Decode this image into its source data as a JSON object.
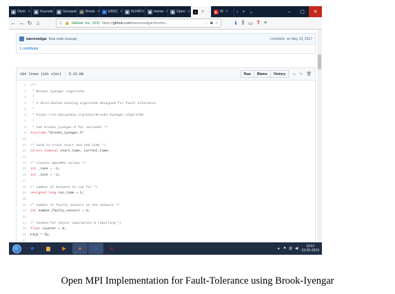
{
  "browser": {
    "tabs": [
      {
        "label": "Olym",
        "icon": "globe-icon"
      },
      {
        "label": "Keynote",
        "icon": "globe-icon"
      },
      {
        "label": "Geospatia",
        "icon": "globe-icon"
      },
      {
        "label": "Brook",
        "icon": "w-icon"
      },
      {
        "label": "EBSC",
        "icon": "ebsco-icon"
      },
      {
        "label": "8c2467c1",
        "icon": "globe-icon"
      },
      {
        "label": "meme",
        "icon": "globe-icon"
      },
      {
        "label": "Open",
        "icon": "globe-icon"
      },
      {
        "label": "",
        "icon": "github-icon",
        "active": true
      },
      {
        "label": "W",
        "icon": "youtube-icon"
      }
    ],
    "new_tab": "+",
    "url": {
      "site_identity": "GitHub, Inc. (US)",
      "prefix": "https://",
      "host": "github.com",
      "path": "/warrenedgar/brooks..."
    }
  },
  "commit": {
    "author": "warrenedgar",
    "message": "final code cleanup",
    "sha": "c4eb96d",
    "date": "on May 19, 2017",
    "contributors": "1 contributor"
  },
  "file": {
    "lines_info": "194 lines (161 sloc)",
    "size": "5.23 KB",
    "buttons": {
      "raw": "Raw",
      "blame": "Blame",
      "history": "History"
    }
  },
  "code_lines": [
    {
      "n": "1",
      "t": "/**",
      "c": "comment"
    },
    {
      "n": "2",
      "t": " * Brooks Iyengar Algorithm",
      "c": "comment"
    },
    {
      "n": "3",
      "t": " *",
      "c": "comment"
    },
    {
      "n": "4",
      "t": " * A distributed sensing algorithm designed for fault tolerance.",
      "c": "comment"
    },
    {
      "n": "5",
      "t": " *",
      "c": "comment"
    },
    {
      "n": "6",
      "t": " * https://en.wikipedia.org/wiki/Brooks-Iyengar_algorithm",
      "c": "comment"
    },
    {
      "n": "7",
      "t": " *",
      "c": "comment"
    },
    {
      "n": "8",
      "t": " * see brooks_iyengar.h for includes */",
      "c": "comment"
    },
    {
      "n": "9",
      "t": "#include \"brooks_iyengar.h\"",
      "c": "keyword"
    },
    {
      "n": "10",
      "t": "",
      "c": "plain"
    },
    {
      "n": "11",
      "t": "/* used to track start and end time */",
      "c": "comment"
    },
    {
      "n": "12",
      "t": "struct timeval start_time, current_time;",
      "c": "keyword"
    },
    {
      "n": "13",
      "t": "",
      "c": "plain"
    },
    {
      "n": "14",
      "t": "/* classic OpenMPI values */",
      "c": "comment"
    },
    {
      "n": "15",
      "t": "int _rank = -1;",
      "c": "keyword"
    },
    {
      "n": "16",
      "t": "int _size = -1;",
      "c": "keyword"
    },
    {
      "n": "17",
      "t": "",
      "c": "plain"
    },
    {
      "n": "18",
      "t": "/* number of minutes to run for */",
      "c": "comment"
    },
    {
      "n": "19",
      "t": "unsigned long run_time = 1;",
      "c": "keyword"
    },
    {
      "n": "20",
      "t": "",
      "c": "plain"
    },
    {
      "n": "21",
      "t": "/* number of faulty sensors in the network */",
      "c": "comment"
    },
    {
      "n": "22",
      "t": "int number_faulty_sensors = 3;",
      "c": "keyword"
    },
    {
      "n": "23",
      "t": "",
      "c": "plain"
    },
    {
      "n": "24",
      "t": "/* needed for sensor simulation & reporting */",
      "c": "comment"
    },
    {
      "n": "25",
      "t": "float counter = 0;",
      "c": "keyword"
    },
    {
      "n": "26",
      "t": "FILE * fp;",
      "c": "plain"
    },
    {
      "n": "27",
      "t": "",
      "c": "plain"
    }
  ],
  "taskbar": {
    "apps": [
      "ie-icon",
      "explorer-icon",
      "media-icon",
      "firefox-icon",
      "word-icon",
      "acrobat-icon"
    ],
    "time": "19:57",
    "date": "23-05-2019"
  },
  "caption": "Open MPI Implementation for Fault-Tolerance using Brook-Iyengar",
  "colors": {
    "accent": "#0366d6",
    "tabbar": "#0f1e35",
    "taskbar": "#1f2d45",
    "comment": "#6a737d",
    "keyword": "#d73a49"
  }
}
